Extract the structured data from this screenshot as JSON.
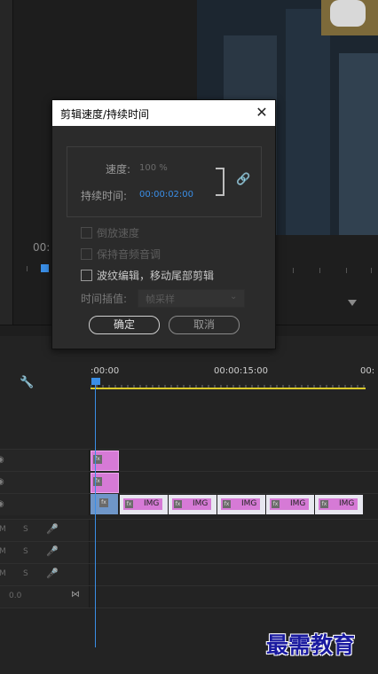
{
  "dialog": {
    "title": "剪辑速度/持续时间",
    "close_icon": "close-icon",
    "speed_label": "速度:",
    "speed_value": "100 %",
    "duration_label": "持续时间:",
    "duration_value": "00:00:02:00",
    "link_icon": "link-icon",
    "reverse_label": "倒放速度",
    "reverse_checked": false,
    "maintain_pitch_label": "保持音频音调",
    "maintain_pitch_checked": false,
    "ripple_label": "波纹编辑，移动尾部剪辑",
    "ripple_checked": false,
    "interpolation_label": "时间插值:",
    "interpolation_value": "帧采样",
    "ok_label": "确定",
    "cancel_label": "取消"
  },
  "program_monitor": {
    "timecode_partial": "00:"
  },
  "timeline": {
    "timecodes": [
      ":00:00",
      "00:00:15:00",
      "00:"
    ],
    "video_clip_label": "IMG",
    "audio_level": "0.0",
    "track_controls": {
      "mute": "M",
      "solo": "S"
    }
  },
  "colors": {
    "accent_blue": "#3a8ee6",
    "clip_pink": "#d67ad6",
    "work_area_yellow": "#d9c82a",
    "video_clip_blue": "#6f96c8"
  },
  "watermark": "最需教育"
}
